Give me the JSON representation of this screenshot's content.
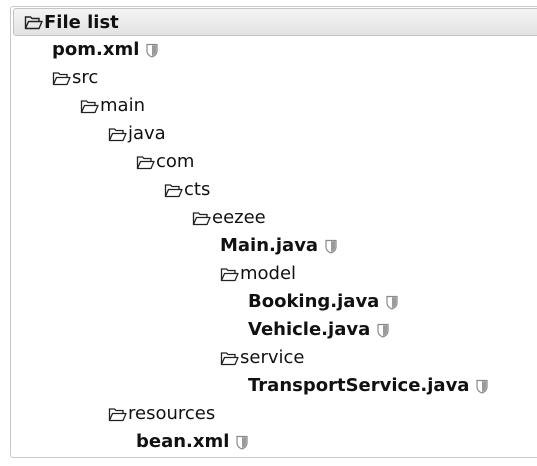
{
  "header": {
    "title": "File list",
    "icon": "folder-open-icon"
  },
  "tree": [
    {
      "name": "pom.xml",
      "kind": "file",
      "depth": 0
    },
    {
      "name": "src",
      "kind": "folder",
      "depth": 0
    },
    {
      "name": "main",
      "kind": "folder",
      "depth": 1
    },
    {
      "name": "java",
      "kind": "folder",
      "depth": 2
    },
    {
      "name": "com",
      "kind": "folder",
      "depth": 3
    },
    {
      "name": "cts",
      "kind": "folder",
      "depth": 4
    },
    {
      "name": "eezee",
      "kind": "folder",
      "depth": 5
    },
    {
      "name": "Main.java",
      "kind": "file",
      "depth": 6
    },
    {
      "name": "model",
      "kind": "folder",
      "depth": 6
    },
    {
      "name": "Booking.java",
      "kind": "file",
      "depth": 7
    },
    {
      "name": "Vehicle.java",
      "kind": "file",
      "depth": 7
    },
    {
      "name": "service",
      "kind": "folder",
      "depth": 6
    },
    {
      "name": "TransportService.java",
      "kind": "file",
      "depth": 7
    },
    {
      "name": "resources",
      "kind": "folder",
      "depth": 2
    },
    {
      "name": "bean.xml",
      "kind": "file",
      "depth": 3
    }
  ],
  "icons": {
    "folder": "folder-open-icon",
    "file_badge": "shield-icon"
  }
}
